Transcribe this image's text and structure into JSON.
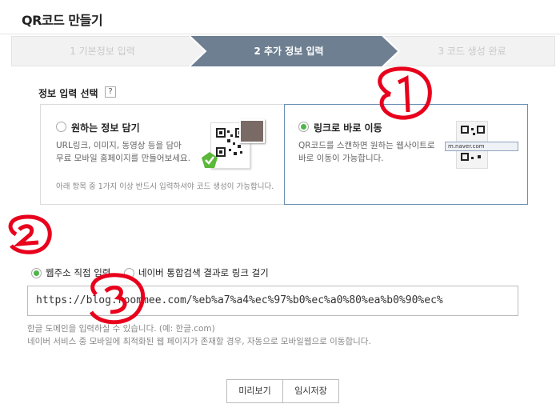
{
  "page": {
    "title": "QR코드 만들기"
  },
  "steps": [
    {
      "label": "1 기본정보 입력",
      "state": "done"
    },
    {
      "label": "2 추가 정보 입력",
      "state": "active"
    },
    {
      "label": "3 코드 생성 완료",
      "state": "pending"
    }
  ],
  "info_select": {
    "label": "정보 입력 선택",
    "help": "?"
  },
  "options": {
    "left": {
      "title": "원하는 정보 담기",
      "desc_line1": "URL링크, 이미지, 동영상 등을 담아",
      "desc_line2": "무료 모바일 홈페이지를 만들어보세요.",
      "note": "아래 항목 중 1가지 이상 반드시 입력하셔야 코드 생성이 가능합니다.",
      "selected": false
    },
    "right": {
      "title": "링크로 바로 이동",
      "desc_line1": "QR코드를 스캔하면 원하는 웹사이트로",
      "desc_line2": "바로 이동이 가능합니다.",
      "url_sample": "m.naver.com",
      "selected": true
    }
  },
  "link_mode": {
    "direct": {
      "label": "웹주소 직접 입력",
      "selected": true
    },
    "search": {
      "label": "네이버 통합검색 결과로 링크 걸기",
      "selected": false
    }
  },
  "url_input": {
    "value": "https://blog.roommee.com/%eb%a7%a4%ec%97%b0%ec%a0%80%ea%b0%90%ec%"
  },
  "hints": {
    "line1": "한글 도메인을 입력하실 수 있습니다. (예: 한글.com)",
    "line2": "네이버 서비스 중 모바일에 최적화된 웹 페이지가 존재할 경우, 자동으로 모바일웹으로 이동합니다."
  },
  "buttons": {
    "preview": "미리보기",
    "save": "임시저장"
  },
  "colors": {
    "step_active": "#6d7f91",
    "accent_green": "#4fb54a",
    "annotation": "#e8001c",
    "selected_border": "#6c8fb3"
  }
}
